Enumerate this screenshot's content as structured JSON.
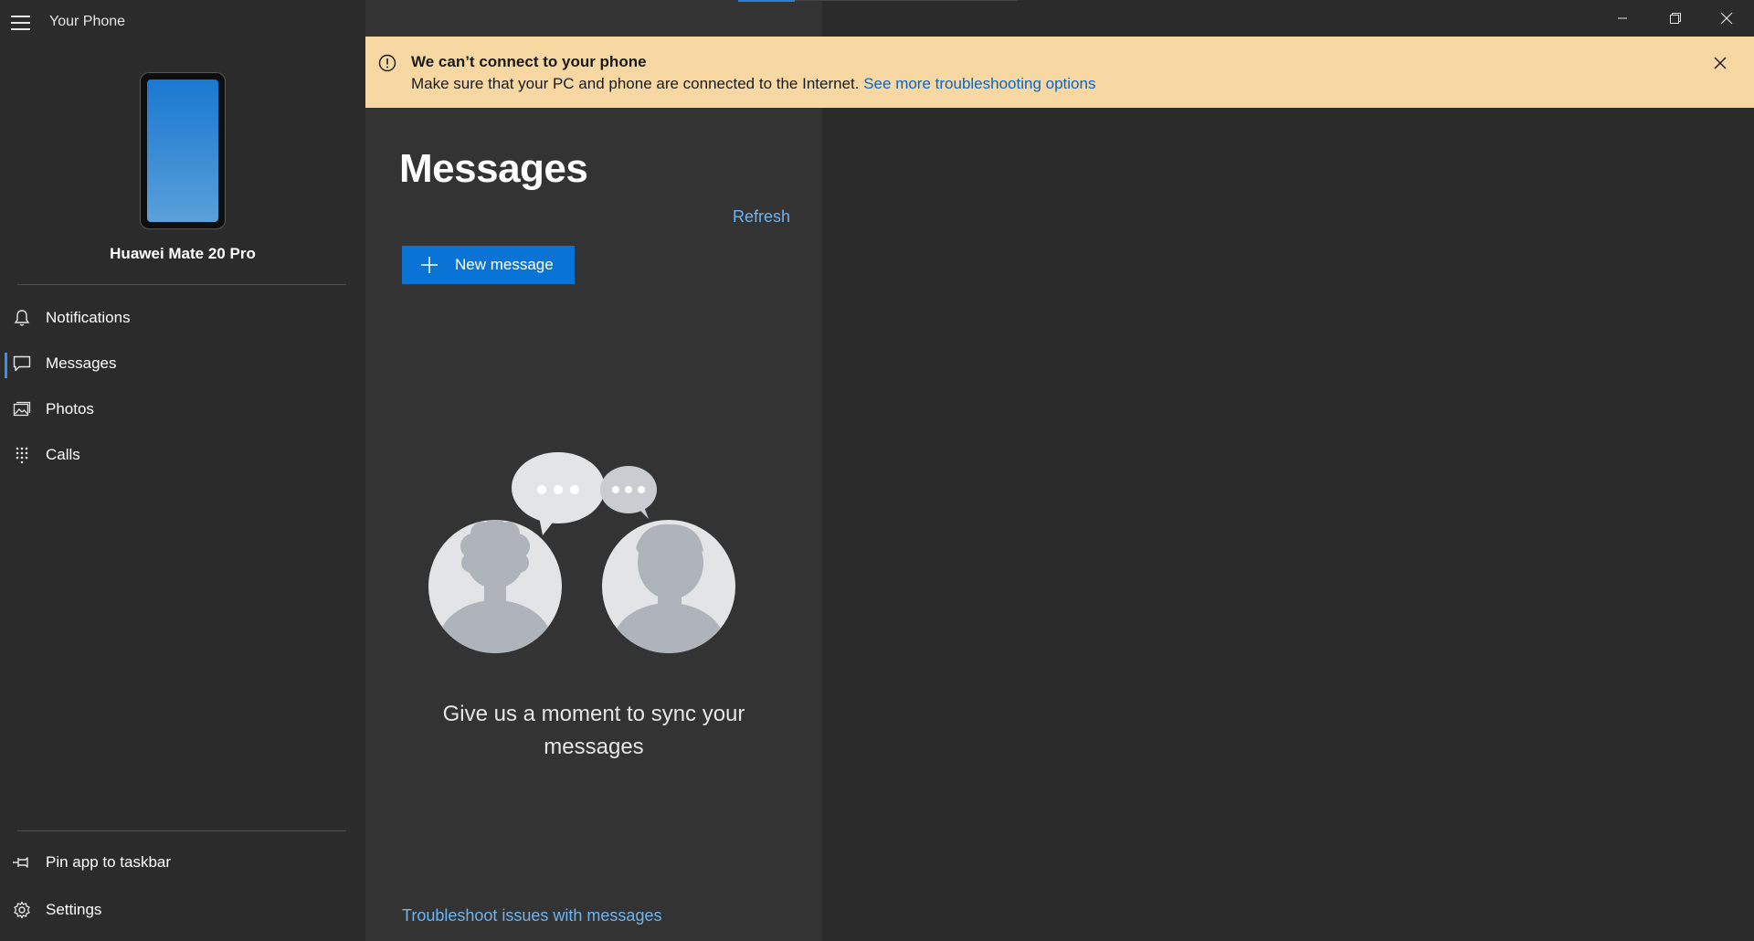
{
  "window": {
    "title": "Your Phone",
    "controls": [
      "minimize-icon",
      "restore-icon",
      "close-icon"
    ]
  },
  "sidebar": {
    "device_name": "Huawei Mate 20 Pro",
    "items": [
      {
        "label": "Notifications",
        "icon": "bell-icon"
      },
      {
        "label": "Messages",
        "icon": "chat-bubble-icon",
        "active": true
      },
      {
        "label": "Photos",
        "icon": "photos-icon"
      },
      {
        "label": "Calls",
        "icon": "dialpad-icon"
      }
    ],
    "footer_items": [
      {
        "label": "Pin app to taskbar",
        "icon": "pin-icon"
      },
      {
        "label": "Settings",
        "icon": "gear-icon"
      }
    ]
  },
  "banner": {
    "title": "We can’t connect to your phone",
    "message": "Make sure that your PC and phone are connected to the Internet.",
    "link": "See more troubleshooting options",
    "icon": "info-circle-icon",
    "close_icon": "close-icon"
  },
  "messages": {
    "title": "Messages",
    "refresh_label": "Refresh",
    "new_message_label": "New message",
    "sync_text": "Give us a moment to sync your messages",
    "troubleshoot_label": "Troubleshoot issues with messages"
  },
  "colors": {
    "accent": "#0a74d6",
    "link": "#6cb4f2",
    "banner_bg": "#f8d8a2",
    "sidebar_bg": "#2b2b2b",
    "pane_bg": "#333333"
  }
}
